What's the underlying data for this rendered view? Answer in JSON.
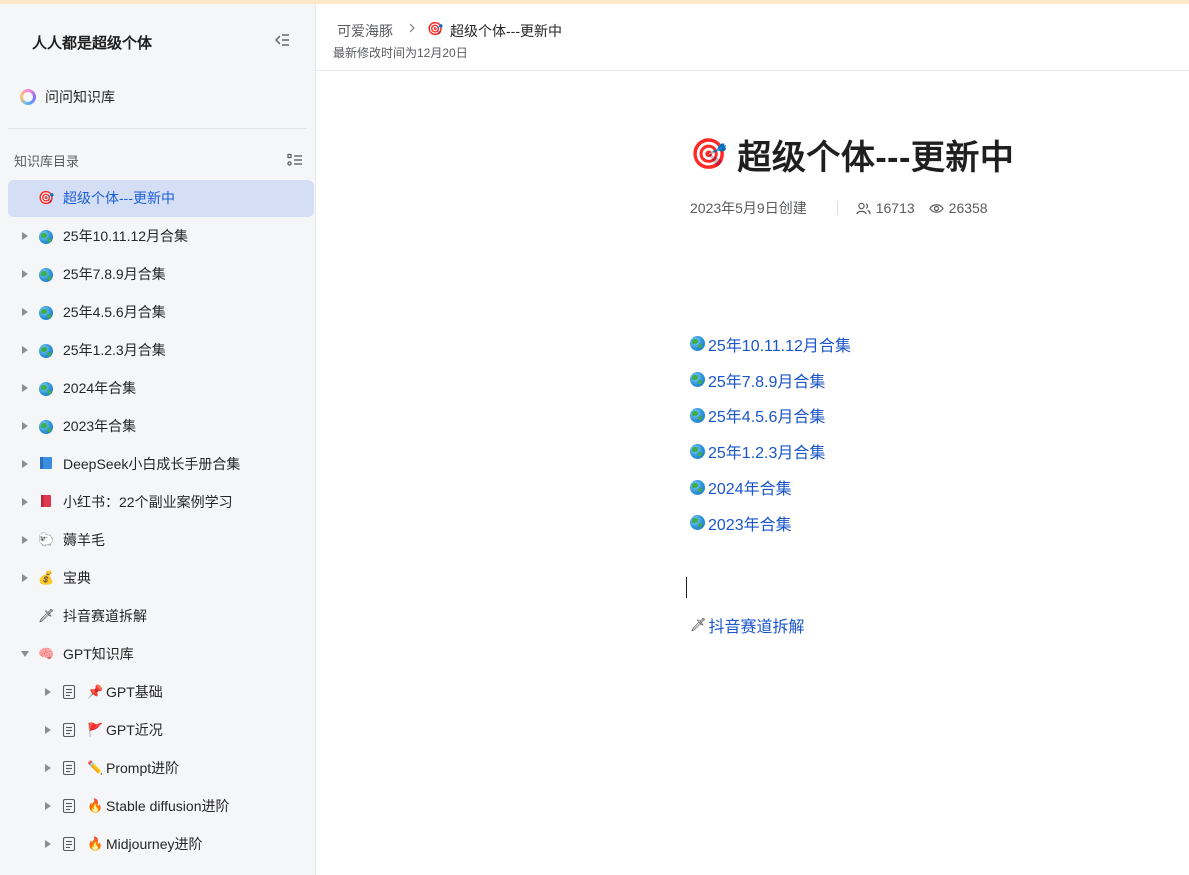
{
  "sidebar": {
    "title": "人人都是超级个体",
    "ask_label": "问问知识库",
    "toc_heading": "知识库目录",
    "items": [
      {
        "label": "超级个体---更新中",
        "icon": "target-dart-icon"
      },
      {
        "label": "25年10.11.12月合集",
        "icon": "globe-icon"
      },
      {
        "label": "25年7.8.9月合集",
        "icon": "globe-icon"
      },
      {
        "label": "25年4.5.6月合集",
        "icon": "globe-icon"
      },
      {
        "label": "25年1.2.3月合集",
        "icon": "globe-icon"
      },
      {
        "label": "2024年合集",
        "icon": "globe-icon"
      },
      {
        "label": "2023年合集",
        "icon": "globe-icon"
      },
      {
        "label": "DeepSeek小白成长手册合集",
        "icon": "blue-book-icon"
      },
      {
        "label": "小红书：22个副业案例学习",
        "icon": "red-book-icon"
      },
      {
        "label": "薅羊毛",
        "icon": "sheep-icon"
      },
      {
        "label": "宝典",
        "icon": "money-bag-icon"
      },
      {
        "label": "抖音赛道拆解",
        "icon": "sword-icon"
      },
      {
        "label": "GPT知识库",
        "icon": "brain-icon"
      }
    ],
    "children": [
      {
        "label": "GPT基础",
        "icon": "pushpin-icon"
      },
      {
        "label": "GPT近况",
        "icon": "flag-icon"
      },
      {
        "label": "Prompt进阶",
        "icon": "pencil-icon"
      },
      {
        "label": "Stable diffusion进阶",
        "icon": "fire-icon"
      },
      {
        "label": "Midjourney进阶",
        "icon": "fire-icon"
      }
    ]
  },
  "header": {
    "breadcrumb_root": "可爱海豚",
    "breadcrumb_current": "超级个体---更新中",
    "modified": "最新修改时间为12月20日"
  },
  "doc": {
    "title": "超级个体---更新中",
    "created": "2023年5月9日创建",
    "members": "16713",
    "views": "26358",
    "links": [
      "25年10.11.12月合集",
      "25年7.8.9月合集",
      "25年4.5.6月合集",
      "25年1.2.3月合集",
      "2024年合集",
      "2023年合集"
    ],
    "douyin_link": "抖音赛道拆解"
  },
  "colors": {
    "accent": "#1a55c9",
    "active_bg": "#d4def5",
    "sidebar_bg": "#f5f6f8",
    "top_strip": "#fde9c9"
  }
}
